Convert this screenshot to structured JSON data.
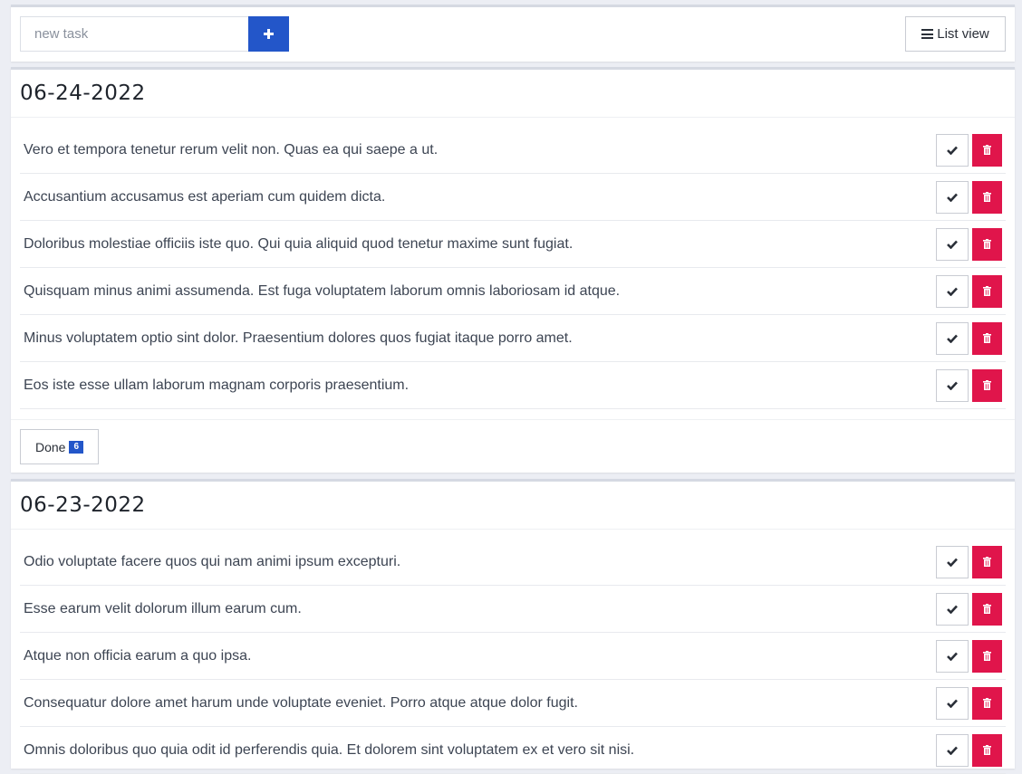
{
  "toolbar": {
    "input_placeholder": "new task",
    "input_value": "",
    "add_icon": "plus-icon",
    "list_view_label": "List view",
    "list_view_icon": "list-icon"
  },
  "groups": [
    {
      "date": "06-24-2022",
      "tasks": [
        "Vero et tempora tenetur rerum velit non. Quas ea qui saepe a ut.",
        "Accusantium accusamus est aperiam cum quidem dicta.",
        "Doloribus molestiae officiis iste quo. Qui quia aliquid quod tenetur maxime sunt fugiat.",
        "Quisquam minus animi assumenda. Est fuga voluptatem laborum omnis laboriosam id atque.",
        "Minus voluptatem optio sint dolor. Praesentium dolores quos fugiat itaque porro amet.",
        "Eos iste esse ullam laborum magnam corporis praesentium."
      ],
      "done_label": "Done",
      "done_count": "6"
    },
    {
      "date": "06-23-2022",
      "tasks": [
        "Odio voluptate facere quos qui nam animi ipsum excepturi.",
        "Esse earum velit dolorum illum earum cum.",
        "Atque non officia earum a quo ipsa.",
        "Consequatur dolore amet harum unde voluptate eveniet. Porro atque atque dolor fugit.",
        "Omnis doloribus quo quia odit id perferendis quia. Et dolorem sint voluptatem ex et vero sit nisi."
      ]
    }
  ],
  "colors": {
    "primary": "#2356c9",
    "danger": "#e0154b",
    "background": "#eceef4"
  },
  "icons": {
    "complete": "check-icon",
    "delete": "trash-icon"
  }
}
